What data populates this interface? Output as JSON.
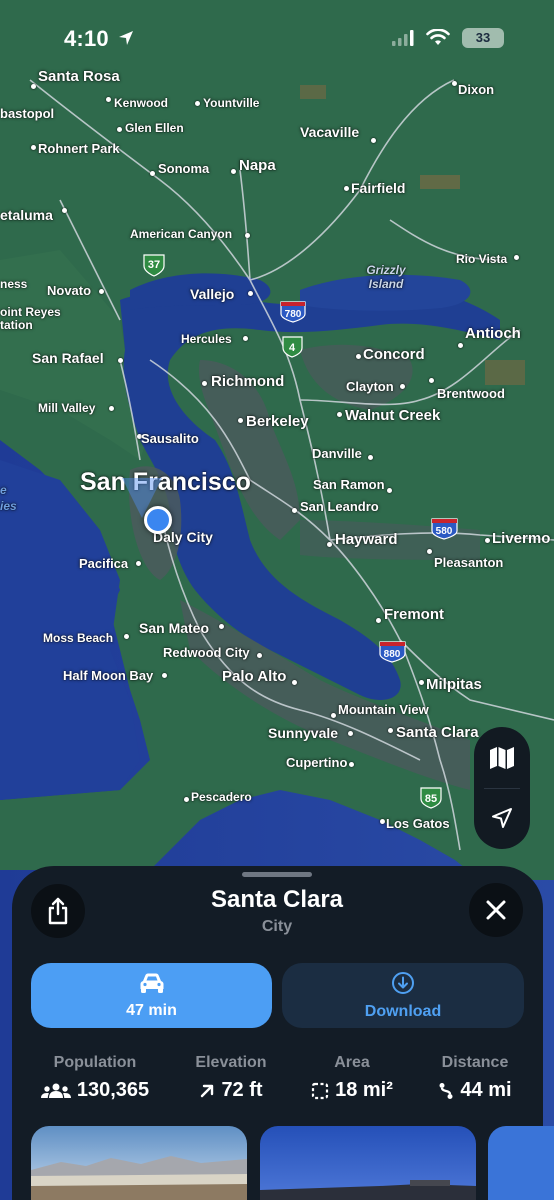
{
  "status_bar": {
    "time": "4:10",
    "battery": "33"
  },
  "map": {
    "labels": {
      "santa_rosa": "Santa Rosa",
      "sebastopol": "bastopol",
      "kenwood": "Kenwood",
      "yountville": "Yountville",
      "glen_ellen": "Glen Ellen",
      "dixon": "Dixon",
      "rohnert_park": "Rohnert Park",
      "vacaville": "Vacaville",
      "sonoma": "Sonoma",
      "napa": "Napa",
      "petaluma": "etaluma",
      "fairfield": "Fairfield",
      "american_canyon": "American Canyon",
      "grizzly_island": "Grizzly Island",
      "rio_vista": "Rio Vista",
      "novato": "Novato",
      "vallejo": "Vallejo",
      "ness": "ness",
      "point_reyes": "oint Reyes",
      "station": "tation",
      "hercules": "Hercules",
      "antioch": "Antioch",
      "san_rafael": "San Rafael",
      "concord": "Concord",
      "richmond": "Richmond",
      "clayton": "Clayton",
      "brentwood": "Brentwood",
      "mill_valley": "Mill Valley",
      "walnut_creek": "Walnut Creek",
      "berkeley": "Berkeley",
      "sausalito": "Sausalito",
      "danville": "Danville",
      "san_francisco": "San Francisco",
      "san_ramon": "San Ramon",
      "san_leandro": "San Leandro",
      "daly_city": "Daly City",
      "hayward": "Hayward",
      "livermore": "Livermo",
      "pacifica": "Pacifica",
      "pleasanton": "Pleasanton",
      "fremont": "Fremont",
      "san_mateo": "San Mateo",
      "moss_beach": "Moss Beach",
      "redwood_city": "Redwood City",
      "half_moon_bay": "Half Moon Bay",
      "palo_alto": "Palo Alto",
      "milpitas": "Milpitas",
      "mountain_view": "Mountain View",
      "sunnyvale": "Sunnyvale",
      "santa_clara": "Santa Clara",
      "cupertino": "Cupertino",
      "pescadero": "Pescadero",
      "los_gatos": "Los Gatos",
      "ocean_partial_1": "e",
      "ocean_partial_2": "ies"
    },
    "highway_shields": {
      "ca37": "37",
      "i780": "780",
      "ca4": "4",
      "i580": "580",
      "i880": "880",
      "ca85": "85"
    },
    "colors": {
      "land": "#2f6a4c",
      "water": "#1e3f92",
      "urban": "#4a5a5e",
      "accent": "#4c9ef4"
    }
  },
  "place_card": {
    "title": "Santa Clara",
    "subtitle": "City",
    "drive_label": "47 min",
    "download_label": "Download",
    "stats": {
      "population": {
        "label": "Population",
        "value": "130,365"
      },
      "elevation": {
        "label": "Elevation",
        "value": "72 ft"
      },
      "area": {
        "label": "Area",
        "value": "18 mi²"
      },
      "distance": {
        "label": "Distance",
        "value": "44 mi"
      }
    }
  }
}
